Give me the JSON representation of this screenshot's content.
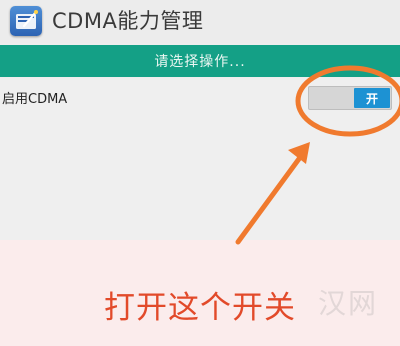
{
  "app": {
    "title": "CDMA能力管理",
    "icon": "app-settings-icon"
  },
  "header": {
    "prompt": "请选择操作..."
  },
  "settings": [
    {
      "label": "启用CDMA",
      "toggle_state_label": "开",
      "enabled": true
    }
  ],
  "annotation": {
    "caption": "打开这个开关",
    "highlight_color": "#f07a2e",
    "caption_color": "#e24a2a"
  },
  "watermark": {
    "text": "汉网"
  },
  "colors": {
    "header_bg": "#14a086",
    "toggle_on": "#1d92d3"
  }
}
